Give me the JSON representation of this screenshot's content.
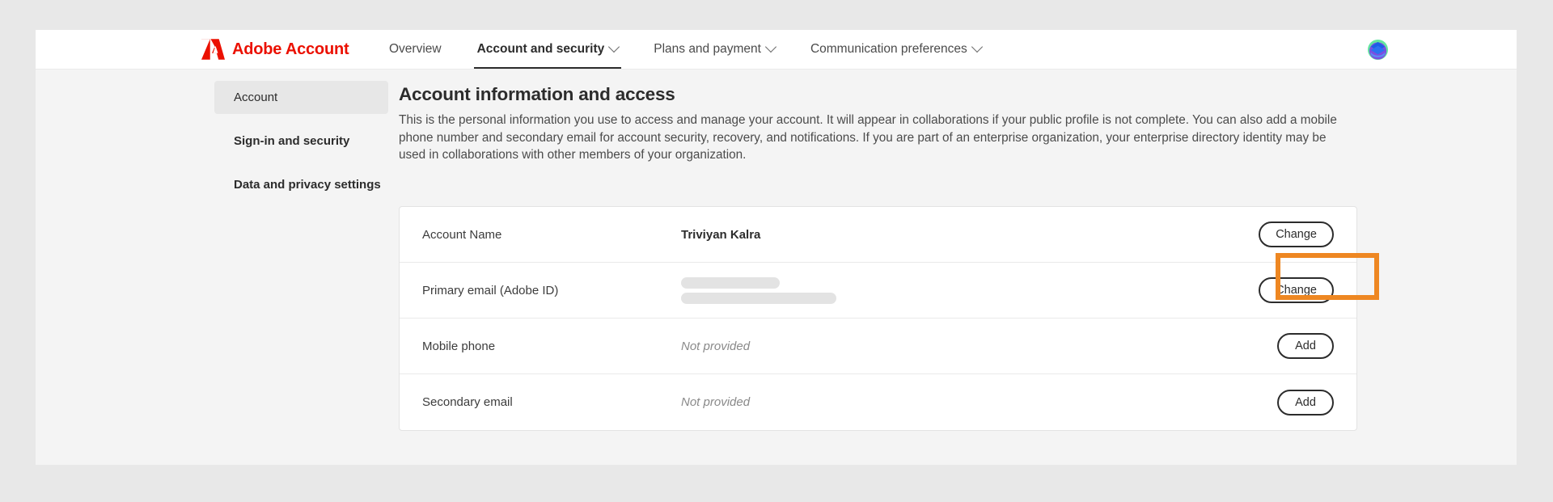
{
  "brand": {
    "name": "Adobe Account",
    "logo_icon": "adobe-logo-icon",
    "accent_color": "#eb1000"
  },
  "nav": {
    "items": [
      {
        "label": "Overview",
        "has_chevron": false,
        "active": false
      },
      {
        "label": "Account and security",
        "has_chevron": true,
        "active": true
      },
      {
        "label": "Plans and payment",
        "has_chevron": true,
        "active": false
      },
      {
        "label": "Communication preferences",
        "has_chevron": true,
        "active": false
      }
    ],
    "avatar_icon": "user-avatar-icon"
  },
  "sidebar": {
    "items": [
      {
        "label": "Account",
        "selected": true
      },
      {
        "label": "Sign-in and security",
        "selected": false
      },
      {
        "label": "Data and privacy settings",
        "selected": false
      }
    ]
  },
  "main": {
    "title": "Account information and access",
    "description": "This is the personal information you use to access and manage your account. It will appear in collaborations if your public profile is not complete. You can also add a mobile phone number and secondary email for account security, recovery, and notifications. If you are part of an enterprise organization, your enterprise directory identity may be used in collaborations with other members of your organization."
  },
  "table": {
    "rows": [
      {
        "label": "Account Name",
        "value": "Triviyan Kalra",
        "value_style": "bold",
        "action": "Change",
        "highlighted": true
      },
      {
        "label": "Primary email (Adobe ID)",
        "value": "",
        "value_style": "redacted",
        "action": "Change",
        "highlighted": false
      },
      {
        "label": "Mobile phone",
        "value": "Not provided",
        "value_style": "muted",
        "action": "Add",
        "highlighted": false
      },
      {
        "label": "Secondary email",
        "value": "Not provided",
        "value_style": "muted",
        "action": "Add",
        "highlighted": false
      }
    ]
  },
  "highlight": {
    "color": "#ee8722",
    "target": "Change"
  }
}
